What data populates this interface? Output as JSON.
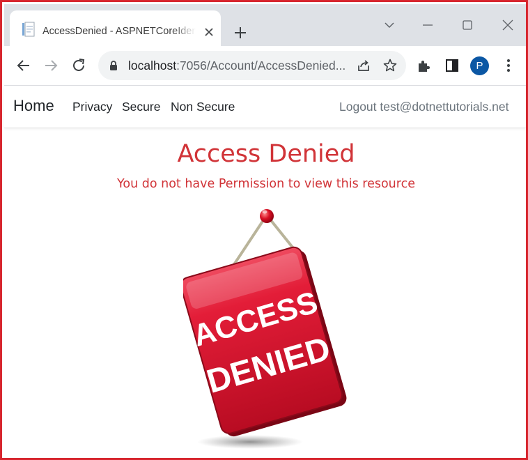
{
  "browser": {
    "tab_title": "AccessDenied - ASPNETCoreIdentityDemo",
    "url_host": "localhost",
    "url_rest": ":7056/Account/AccessDenied...",
    "profile_initial": "P"
  },
  "nav": {
    "brand": "Home",
    "items": [
      "Privacy",
      "Secure",
      "Non Secure"
    ],
    "logout": "Logout test@dotnettutorials.net"
  },
  "content": {
    "title": "Access Denied",
    "subtitle": "You do not have Permission to view this resource",
    "sign_text": [
      "ACCESS",
      "DENIED"
    ]
  },
  "colors": {
    "frame_border": "#d7262e",
    "heading": "#d13438",
    "sign_red": "#d8102a",
    "avatar": "#0b57a4"
  },
  "icons": [
    "page-favicon",
    "close-icon",
    "plus-icon",
    "chevron-down-icon",
    "minimize-icon",
    "maximize-icon",
    "close-window-icon",
    "back-arrow-icon",
    "forward-arrow-icon",
    "reload-icon",
    "lock-icon",
    "share-icon",
    "star-icon",
    "extensions-icon",
    "side-panel-icon",
    "kebab-menu-icon"
  ]
}
